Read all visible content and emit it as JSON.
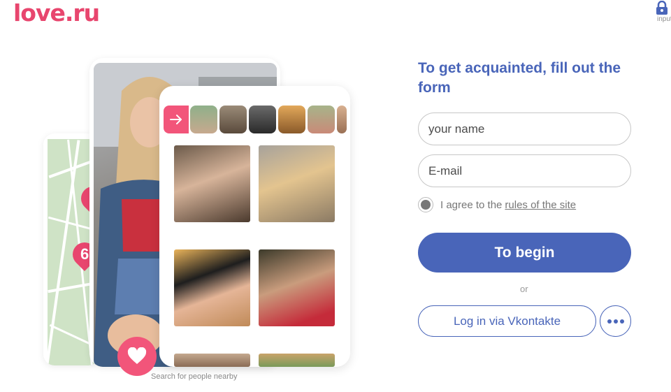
{
  "header": {
    "logo": "love.ru",
    "login_label": "input",
    "login_icon": "lock-icon"
  },
  "promo": {
    "map_pin_number": "6",
    "caption": "Search for people nearby",
    "arrow_icon": "arrow-right-icon",
    "heart_icon": "heart-icon",
    "accent_color": "#f2557a"
  },
  "form": {
    "title": "To get acquainted, fill out the form",
    "name_placeholder": "your name",
    "email_placeholder": "E-mail",
    "agree_text": "I agree to the",
    "agree_link": "rules of the site",
    "submit_label": "To begin",
    "or_label": "or",
    "vk_label": "Log in via Vkontakte",
    "more_icon": "more-dots-icon",
    "primary_color": "#4965b9"
  }
}
